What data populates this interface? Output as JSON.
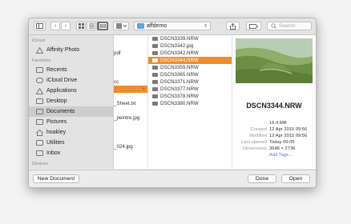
{
  "toolbar": {
    "path_label": "affdemo",
    "search_placeholder": "Search"
  },
  "sidebar": {
    "icloud_header": "iCloud",
    "icloud_items": [
      {
        "label": "Affinity Photo",
        "icon": "affinity-icon"
      }
    ],
    "favorites_header": "Favorites",
    "favorites_items": [
      {
        "label": "Recents",
        "icon": "recents-icon"
      },
      {
        "label": "iCloud Drive",
        "icon": "cloud-icon"
      },
      {
        "label": "Applications",
        "icon": "applications-icon"
      },
      {
        "label": "Desktop",
        "icon": "desktop-icon"
      },
      {
        "label": "Documents",
        "icon": "documents-icon",
        "selected": true
      },
      {
        "label": "Pictures",
        "icon": "pictures-icon"
      },
      {
        "label": "hoakley",
        "icon": "home-icon"
      },
      {
        "label": "Utilities",
        "icon": "folder-icon"
      },
      {
        "label": "Inbox",
        "icon": "folder-icon"
      }
    ],
    "devices_header": "Devices"
  },
  "column1": {
    "items": [
      "",
      "",
      "pdf",
      "",
      "",
      "",
      "cc",
      "",
      "",
      "_Sheet.txt",
      "",
      "_peintre.jpg",
      "",
      "",
      "",
      "_024.jpg"
    ]
  },
  "column2": {
    "items": [
      "DSCN3339.NRW",
      "DSCN3342.jpg",
      "DSCN3342.NRW",
      "DSCN3344.NRW",
      "DSCN3359.NRW",
      "DSCN3365.NRW",
      "DSCN3371.NRW",
      "DSCN3377.NRW",
      "DSCN3378.NRW",
      "DSCN3380.NRW"
    ],
    "selected_index": 3
  },
  "preview": {
    "filename": "DSCN3344.NRW",
    "size": "16.4 MB",
    "created_label": "Created",
    "created": "12 Apr 2015 09:56",
    "modified_label": "Modified",
    "modified": "12 Apr 2015 09:56",
    "last_opened_label": "Last opened",
    "last_opened": "Today 09:05",
    "dimensions_label": "Dimensions",
    "dimensions": "3648 × 2736",
    "add_tags": "Add Tags…"
  },
  "footer": {
    "new_document": "New Document",
    "done": "Done",
    "open": "Open"
  },
  "colors": {
    "selection": "#ee8d2a",
    "folder": "#5aa6e6",
    "link": "#4a84d8"
  }
}
